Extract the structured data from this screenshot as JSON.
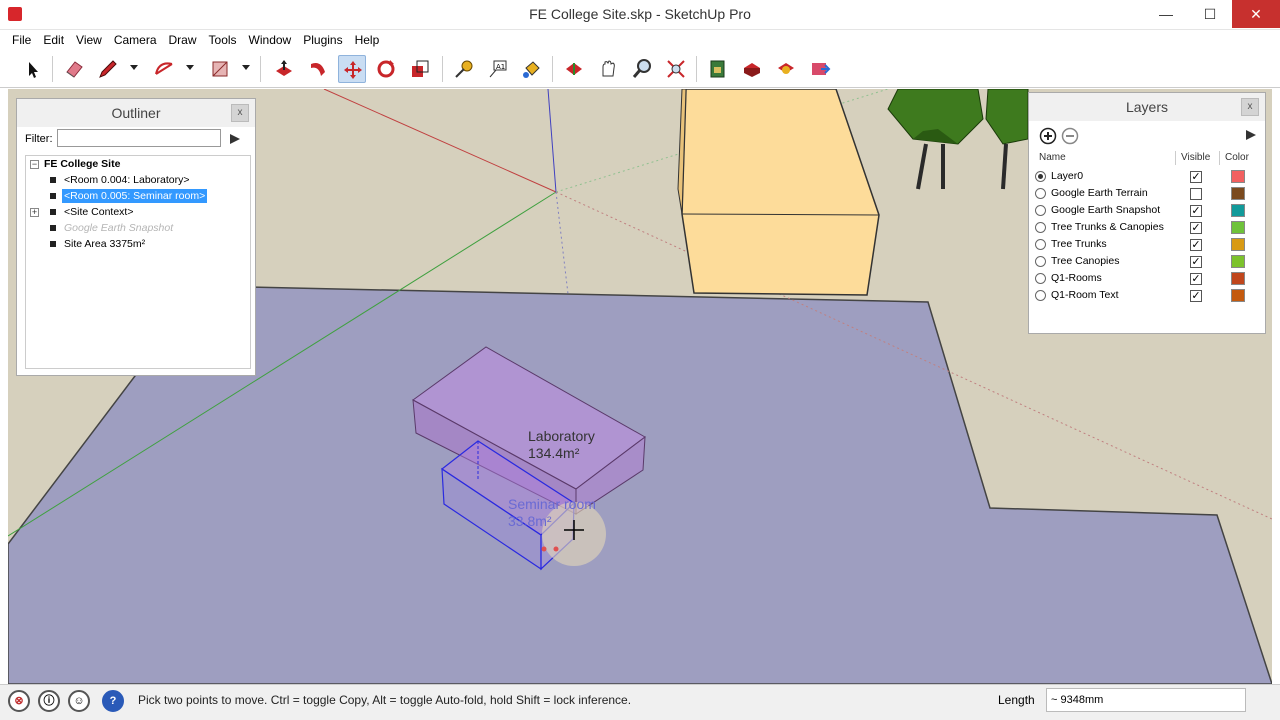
{
  "window": {
    "title": "FE College Site.skp - SketchUp Pro",
    "minimize": "—",
    "maximize": "☐",
    "close": "✕"
  },
  "menu": [
    "File",
    "Edit",
    "View",
    "Camera",
    "Draw",
    "Tools",
    "Window",
    "Plugins",
    "Help"
  ],
  "toolbar": {
    "tools": [
      "select",
      "eraser",
      "pencil",
      "arc",
      "rectangle",
      "push-pull",
      "follow-me",
      "move",
      "rotate",
      "scale",
      "tape-measure",
      "text",
      "paint-bucket",
      "orbit",
      "pan",
      "zoom",
      "zoom-extents",
      "add-location",
      "get-models",
      "share-model",
      "extension"
    ],
    "active_tool": "move"
  },
  "outliner": {
    "title": "Outliner",
    "close": "x",
    "filter_label": "Filter:",
    "filter_value": "",
    "root": "FE College Site",
    "items": [
      {
        "label": "<Room 0.004: Laboratory>",
        "state": "normal",
        "expander": ""
      },
      {
        "label": "<Room 0.005: Seminar room>",
        "state": "selected",
        "expander": ""
      },
      {
        "label": "<Site Context>",
        "state": "normal",
        "expander": "+"
      },
      {
        "label": "Google Earth Snapshot",
        "state": "hidden",
        "expander": ""
      },
      {
        "label": "Site Area  3375m²",
        "state": "normal",
        "expander": ""
      }
    ]
  },
  "layers": {
    "title": "Layers",
    "close": "x",
    "columns": {
      "name": "Name",
      "visible": "Visible",
      "color": "Color"
    },
    "rows": [
      {
        "name": "Layer0",
        "current": true,
        "visible": true,
        "color": "#f26060"
      },
      {
        "name": "Google Earth Terrain",
        "current": false,
        "visible": false,
        "color": "#7a4a1e"
      },
      {
        "name": "Google Earth Snapshot",
        "current": false,
        "visible": true,
        "color": "#129a9a"
      },
      {
        "name": "Tree Trunks & Canopies",
        "current": false,
        "visible": true,
        "color": "#6ec23a"
      },
      {
        "name": "Tree Trunks",
        "current": false,
        "visible": true,
        "color": "#d89a14"
      },
      {
        "name": "Tree Canopies",
        "current": false,
        "visible": true,
        "color": "#7cc22c"
      },
      {
        "name": "Q1-Rooms",
        "current": false,
        "visible": true,
        "color": "#c0461c"
      },
      {
        "name": "Q1-Room Text",
        "current": false,
        "visible": true,
        "color": "#c45a0e"
      }
    ]
  },
  "scene": {
    "lab_label_line1": "Laboratory",
    "lab_label_line2": "134.4m²",
    "seminar_label_line1": "Seminar room",
    "seminar_label_line2": "33.8m²",
    "colors": {
      "ground": "#d6d0bd",
      "site": "#9e9ec0",
      "building": "#fddc9a",
      "lab_room": "#c08ce0",
      "seminar_room": "#2a2ae0",
      "trees": "#3e7a1e"
    }
  },
  "status": {
    "message": "Pick two points to move.  Ctrl = toggle Copy, Alt = toggle Auto-fold, hold Shift = lock inference.",
    "length_label": "Length",
    "length_value": "~ 9348mm",
    "icons": [
      "geo-location-icon",
      "credits-icon",
      "user-icon",
      "help-icon"
    ]
  }
}
